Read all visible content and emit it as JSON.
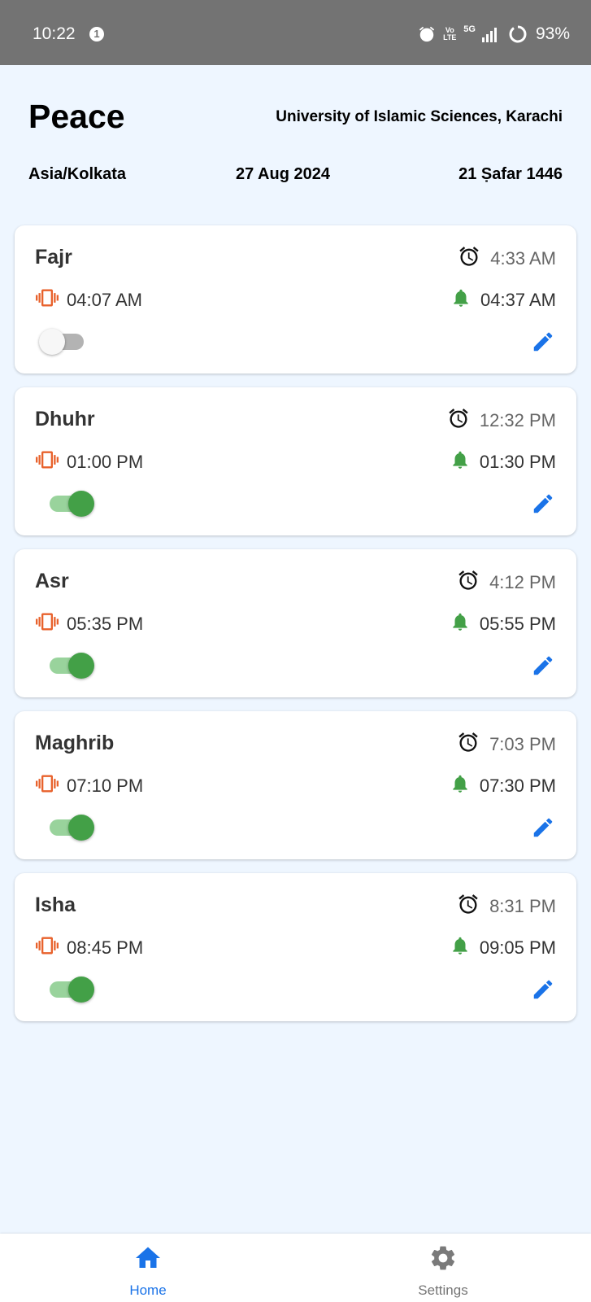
{
  "status_bar": {
    "time": "10:22",
    "notification_count": "1",
    "network_label": "Vo LTE",
    "network_type": "5G",
    "battery_percent": "93%"
  },
  "header": {
    "title": "Peace",
    "calculation_method": "University of Islamic Sciences, Karachi",
    "timezone": "Asia/Kolkata",
    "gregorian_date": "27 Aug 2024",
    "hijri_date": "21 Ṣafar 1446"
  },
  "prayers": [
    {
      "name": "Fajr",
      "adhan_time": "4:33 AM",
      "vibrate_time": "04:07 AM",
      "notify_time": "04:37 AM",
      "enabled": false
    },
    {
      "name": "Dhuhr",
      "adhan_time": "12:32 PM",
      "vibrate_time": "01:00 PM",
      "notify_time": "01:30 PM",
      "enabled": true
    },
    {
      "name": "Asr",
      "adhan_time": "4:12 PM",
      "vibrate_time": "05:35 PM",
      "notify_time": "05:55 PM",
      "enabled": true
    },
    {
      "name": "Maghrib",
      "adhan_time": "7:03 PM",
      "vibrate_time": "07:10 PM",
      "notify_time": "07:30 PM",
      "enabled": true
    },
    {
      "name": "Isha",
      "adhan_time": "8:31 PM",
      "vibrate_time": "08:45 PM",
      "notify_time": "09:05 PM",
      "enabled": true
    }
  ],
  "icons": {
    "adhan": "alarm-clock-icon",
    "vibrate": "vibrate-icon",
    "notify": "bell-icon",
    "edit": "pencil-icon",
    "home": "home-icon",
    "settings": "gear-icon"
  },
  "colors": {
    "background": "#eef6ff",
    "vibrate": "#e8622c",
    "notify": "#43a047",
    "accent": "#1a73e8",
    "toggle_on": "#43a047"
  },
  "bottom_nav": {
    "active": "home",
    "home_label": "Home",
    "settings_label": "Settings"
  }
}
